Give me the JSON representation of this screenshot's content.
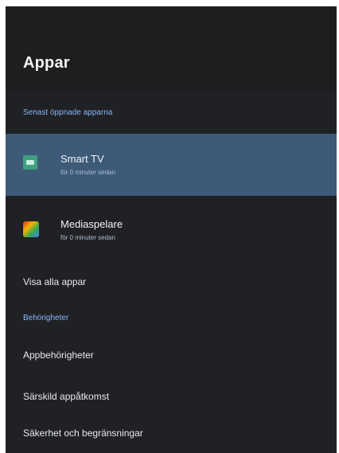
{
  "header": {
    "title": "Appar"
  },
  "recent": {
    "section_label": "Senast öppnade apparna",
    "items": [
      {
        "name": "Smart TV",
        "subtitle": "för 0 minuter sedan",
        "icon": "smart-tv-icon",
        "selected": true
      },
      {
        "name": "Mediaspelare",
        "subtitle": "för 0 minuter sedan",
        "icon": "media-player-icon",
        "selected": false
      }
    ]
  },
  "menu": {
    "show_all": "Visa alla appar",
    "permissions_label": "Behörigheter",
    "app_permissions": "Appbehörigheter",
    "special_access": "Särskild appåtkomst",
    "security": "Säkerhet och begränsningar"
  },
  "colors": {
    "background": "#202124",
    "selected": "#3d5a78",
    "accent_text": "#8ab4f8"
  }
}
